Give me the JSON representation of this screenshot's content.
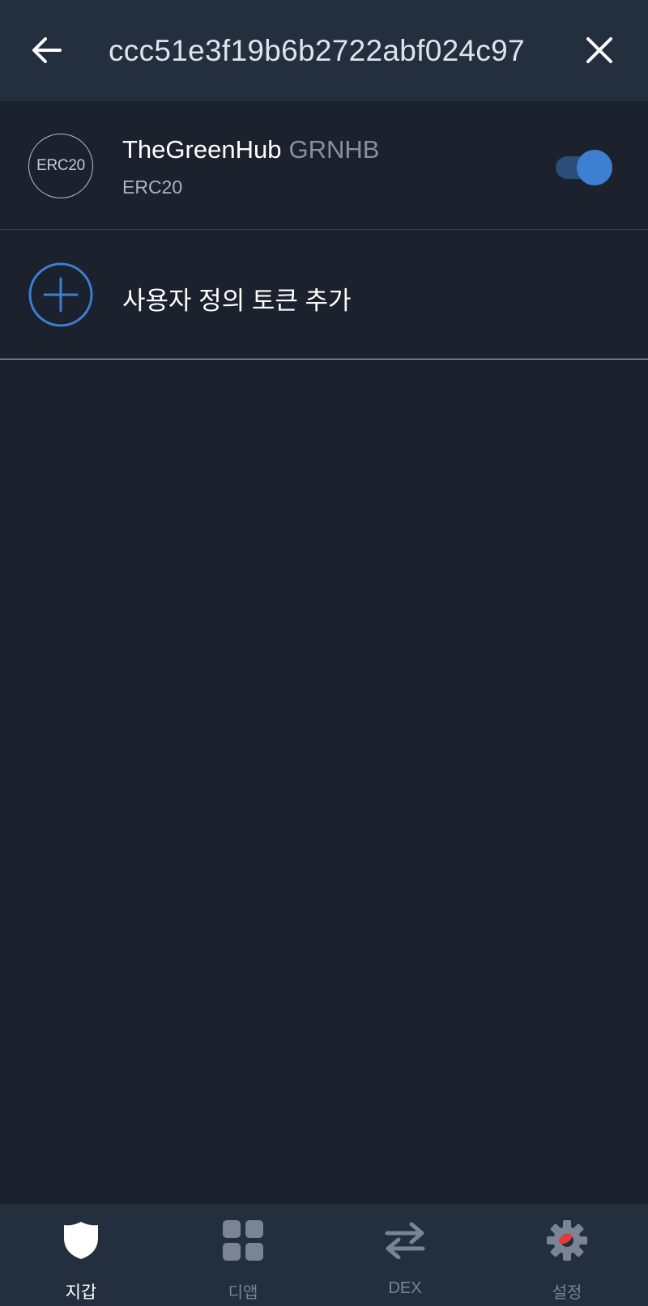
{
  "header": {
    "search_value": "ccc51e3f19b6b2722abf024c97",
    "back_icon": "arrow-left-icon",
    "close_icon": "close-icon"
  },
  "token": {
    "badge_label": "ERC20",
    "name": "TheGreenHub",
    "symbol": "GRNHB",
    "type": "ERC20",
    "enabled": true
  },
  "add_custom_token": {
    "label": "사용자 정의 토큰 추가",
    "icon": "plus-circle-icon"
  },
  "bottom_nav": {
    "items": [
      {
        "label": "지갑",
        "icon": "shield-icon",
        "active": true
      },
      {
        "label": "디앱",
        "icon": "grid-icon",
        "active": false
      },
      {
        "label": "DEX",
        "icon": "swap-icon",
        "active": false
      },
      {
        "label": "설정",
        "icon": "gear-icon",
        "active": false
      }
    ]
  },
  "colors": {
    "background": "#1b212d",
    "header": "#232e3e",
    "accent": "#3d7fd1",
    "muted_text": "#8a909b"
  }
}
